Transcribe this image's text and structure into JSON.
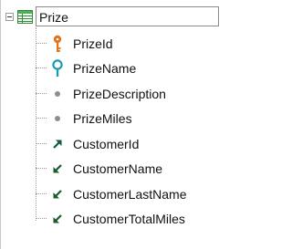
{
  "tree": {
    "root": {
      "label": "Prize",
      "icon": "transaction-table-icon",
      "expanded": true
    },
    "attributes": [
      {
        "label": "PrizeId",
        "icon": "primary-key-icon",
        "key_color": "#e5731a"
      },
      {
        "label": "PrizeName",
        "icon": "search-key-icon",
        "key_color": "#1a9cb0"
      },
      {
        "label": "PrizeDescription",
        "icon": "attribute-dot-icon"
      },
      {
        "label": "PrizeMiles",
        "icon": "attribute-dot-icon"
      },
      {
        "label": "CustomerId",
        "icon": "foreign-key-arrow-icon",
        "arrow_color": "#0f5a4a"
      },
      {
        "label": "CustomerName",
        "icon": "inferred-attribute-arrow-icon",
        "arrow_color": "#1e5a2a"
      },
      {
        "label": "CustomerLastName",
        "icon": "inferred-attribute-arrow-icon",
        "arrow_color": "#1e5a2a"
      },
      {
        "label": "CustomerTotalMiles",
        "icon": "inferred-attribute-arrow-icon",
        "arrow_color": "#1e5a2a"
      }
    ]
  }
}
